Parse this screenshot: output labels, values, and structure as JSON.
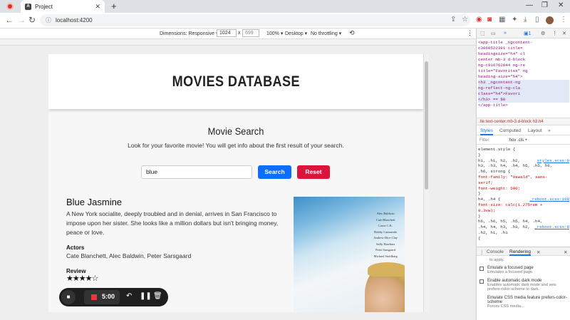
{
  "browser": {
    "tab_title": "Project",
    "url": "localhost:4200"
  },
  "device_toolbar": {
    "dimensions_label": "Dimensions: Responsive",
    "width": "1024",
    "separator": "x",
    "height": "699",
    "zoom": "100%",
    "device_type": "Desktop",
    "throttling": "No throttling"
  },
  "app": {
    "header_title": "MOVIES DATABASE",
    "search_heading": "Movie Search",
    "search_subtitle": "Look for your favorite movie! You will get info about the first result of your search.",
    "search_value": "blue",
    "search_button": "Search",
    "reset_button": "Reset",
    "movie": {
      "title": "Blue Jasmine",
      "description": "A New York socialite, deeply troubled and in denial, arrives in San Francisco to impose upon her sister. She looks like a million dollars but isn't bringing money, peace or love.",
      "actors_label": "Actors",
      "actors": "Cate Blanchett, Alec Baldwin, Peter Sarsgaard",
      "review_label": "Review",
      "rating_stars": "★★★★☆",
      "rating": 4,
      "rating_max": 5,
      "poster_credits": [
        "Alec Baldwin",
        "Cate Blanchett",
        "Louis C.K.",
        "Bobby Cannavale",
        "Andrew Dice Clay",
        "Sally Hawkins",
        "Peter Sarsgaard",
        "Michael Stuhlbarg"
      ]
    }
  },
  "recorder": {
    "timer": "5:00"
  },
  "devtools": {
    "code_lines": [
      "<app-title _ngcontent-",
      "c3060522391 title=",
      "headingsize=\"h4\" cl",
      "center mb-3 d-block",
      "ng-c916762844 ng-re",
      "title=\"Favorites\" ng",
      "heading-size=\"h4\">",
      "<h3 _ngcontent-ng",
      "ng-reflect-ng-cla",
      "class=\"h4\">Favori",
      "</h3> == $0",
      "</app-title>"
    ],
    "breadcrumb": ".tle.text-center.mb-3.d-block   h3.h4",
    "tabs": [
      "Styles",
      "Computed",
      "Layout",
      "»"
    ],
    "filter_placeholder": "Filter",
    "filter_tools": ":hov  .cls  +",
    "styles_lines": [
      "element.style {",
      "}",
      "h1, .h1, h2, .h2,",
      "h3, .h3, h4, .h4, h5, .h5, h6,",
      ".h6, strong {",
      "  font-family: \"Oswald\", sans-",
      "      serif;",
      "  font-weight: 500;",
      "}",
      "h4, .h4 {",
      "  font-size: calc(1.275rem +",
      "      0.3vw);",
      "}",
      "h6, .h6, h5, .h5, h4, .h4,",
      ".h4, h4, h3, .h3, h2, .h2, h1, .h1",
      "{"
    ],
    "styles_src_1": "styles.scss:9",
    "styles_src_2": "_reboot.scss:108",
    "styles_src_3": "_reboot.scss:8",
    "drawer_tabs": [
      "Console",
      "Rendering"
    ],
    "drawer_note": "to apply.",
    "render_options": [
      {
        "title": "Emulate a focused page",
        "desc": "Emulates a focused page."
      },
      {
        "title": "Enable automatic dark mode",
        "desc": "Enables automatic dark mode and sets prefers-color-scheme to dark."
      },
      {
        "title": "Emulate CSS media feature prefers-color-scheme",
        "desc": "Forces CSS media..."
      }
    ]
  },
  "colors": {
    "search_button": "#0d6efd",
    "reset_button": "#dc143c",
    "rec_indicator": "#d93025"
  }
}
